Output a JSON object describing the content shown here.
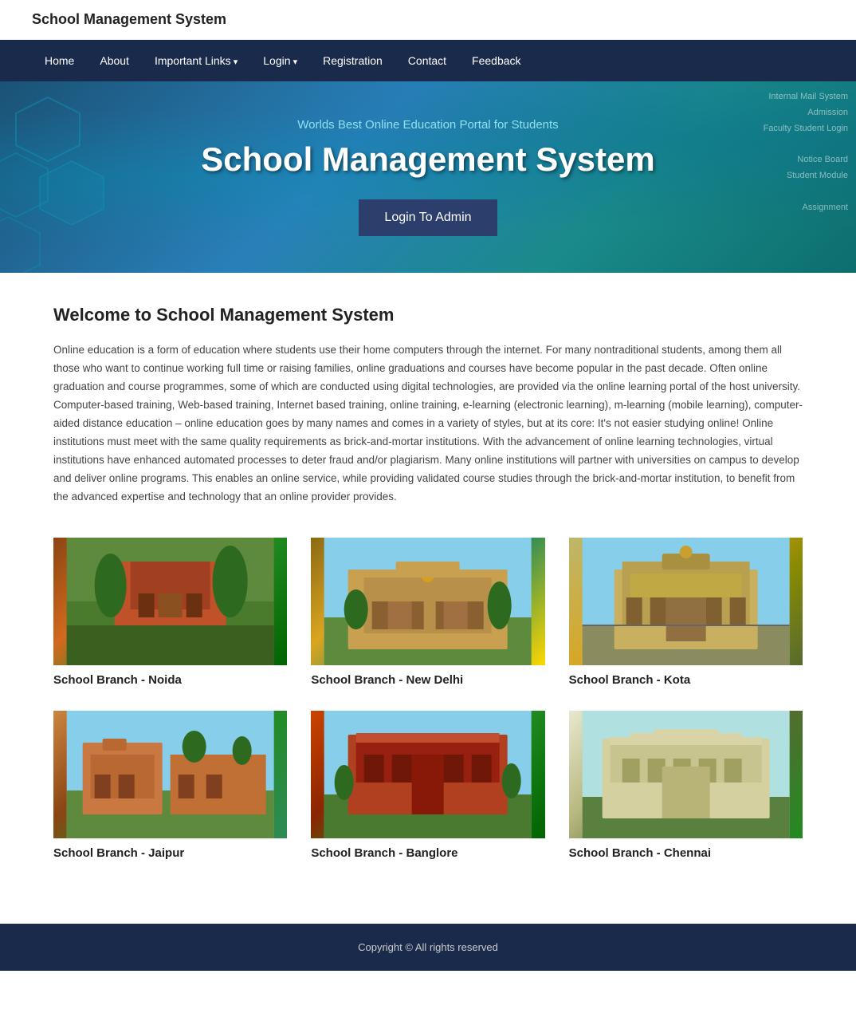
{
  "site": {
    "title": "School Management System"
  },
  "nav": {
    "items": [
      {
        "label": "Home",
        "href": "#",
        "hasDropdown": false
      },
      {
        "label": "About",
        "href": "#",
        "hasDropdown": false
      },
      {
        "label": "Important Links",
        "href": "#",
        "hasDropdown": true
      },
      {
        "label": "Login",
        "href": "#",
        "hasDropdown": true
      },
      {
        "label": "Registration",
        "href": "#",
        "hasDropdown": false
      },
      {
        "label": "Contact",
        "href": "#",
        "hasDropdown": false
      },
      {
        "label": "Feedback",
        "href": "#",
        "hasDropdown": false
      }
    ]
  },
  "hero": {
    "tagline": "Worlds Best Online Education Portal for Students",
    "title": "School Management System",
    "button_label": "Login To Admin"
  },
  "welcome": {
    "title": "Welcome to School Management System",
    "text": "Online education is a form of education where students use their home computers through the internet. For many nontraditional students, among them all those who want to continue working full time or raising families, online graduations and courses have become popular in the past decade. Often online graduation and course programmes, some of which are conducted using digital technologies, are provided via the online learning portal of the host university. Computer-based training, Web-based training, Internet based training, online training, e-learning (electronic learning), m-learning (mobile learning), computer-aided distance education – online education goes by many names and comes in a variety of styles, but at its core: It's not easier studying online! Online institutions must meet with the same quality requirements as brick-and-mortar institutions. With the advancement of online learning technologies, virtual institutions have enhanced automated processes to deter fraud and/or plagiarism. Many online institutions will partner with universities on campus to develop and deliver online programs. This enables an online service, while providing validated course studies through the brick-and-mortar institution, to benefit from the advanced expertise and technology that an online provider provides."
  },
  "branches": [
    {
      "label": "School Branch - Noida",
      "imgClass": "img-noida"
    },
    {
      "label": "School Branch - New Delhi",
      "imgClass": "img-newdelhi"
    },
    {
      "label": "School Branch - Kota",
      "imgClass": "img-kota"
    },
    {
      "label": "School Branch - Jaipur",
      "imgClass": "img-jaipur"
    },
    {
      "label": "School Branch - Banglore",
      "imgClass": "img-banglore"
    },
    {
      "label": "School Branch - Chennai",
      "imgClass": "img-chennai"
    }
  ],
  "footer": {
    "text": "Copyright © All rights reserved"
  }
}
